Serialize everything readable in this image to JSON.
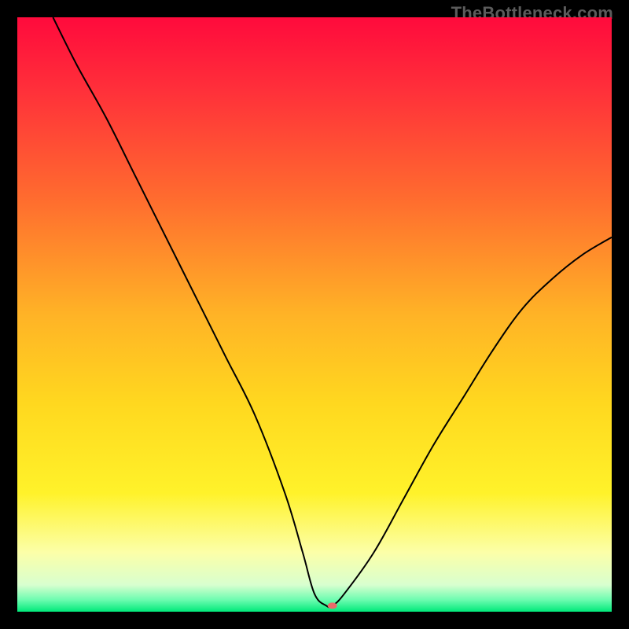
{
  "watermark": "TheBottleneck.com",
  "chart_data": {
    "type": "line",
    "title": "",
    "xlabel": "",
    "ylabel": "",
    "xlim": [
      0,
      100
    ],
    "ylim": [
      0,
      100
    ],
    "grid": false,
    "legend": false,
    "background": "gradient",
    "gradient_stops": [
      {
        "pos": 0.0,
        "color": "#ff0a3c"
      },
      {
        "pos": 0.12,
        "color": "#ff2f3a"
      },
      {
        "pos": 0.3,
        "color": "#ff6a2f"
      },
      {
        "pos": 0.5,
        "color": "#ffb326"
      },
      {
        "pos": 0.65,
        "color": "#ffd81f"
      },
      {
        "pos": 0.8,
        "color": "#fff22a"
      },
      {
        "pos": 0.9,
        "color": "#fcffa8"
      },
      {
        "pos": 0.955,
        "color": "#d8ffcf"
      },
      {
        "pos": 0.98,
        "color": "#6dfcb0"
      },
      {
        "pos": 1.0,
        "color": "#00e97a"
      }
    ],
    "series": [
      {
        "name": "bottleneck-curve",
        "stroke": "#000000",
        "stroke_width": 2,
        "x": [
          6,
          10,
          15,
          20,
          25,
          30,
          35,
          40,
          45,
          48,
          50,
          52,
          53,
          55,
          60,
          65,
          70,
          75,
          80,
          85,
          90,
          95,
          100
        ],
        "y": [
          100,
          92,
          83,
          73,
          63,
          53,
          43,
          33,
          20,
          10,
          3,
          1,
          1,
          3,
          10,
          19,
          28,
          36,
          44,
          51,
          56,
          60,
          63
        ]
      }
    ],
    "marker": {
      "name": "optimal-point",
      "x": 53,
      "y": 1,
      "color": "#ea6a6a",
      "rx": 6,
      "ry": 4
    }
  }
}
